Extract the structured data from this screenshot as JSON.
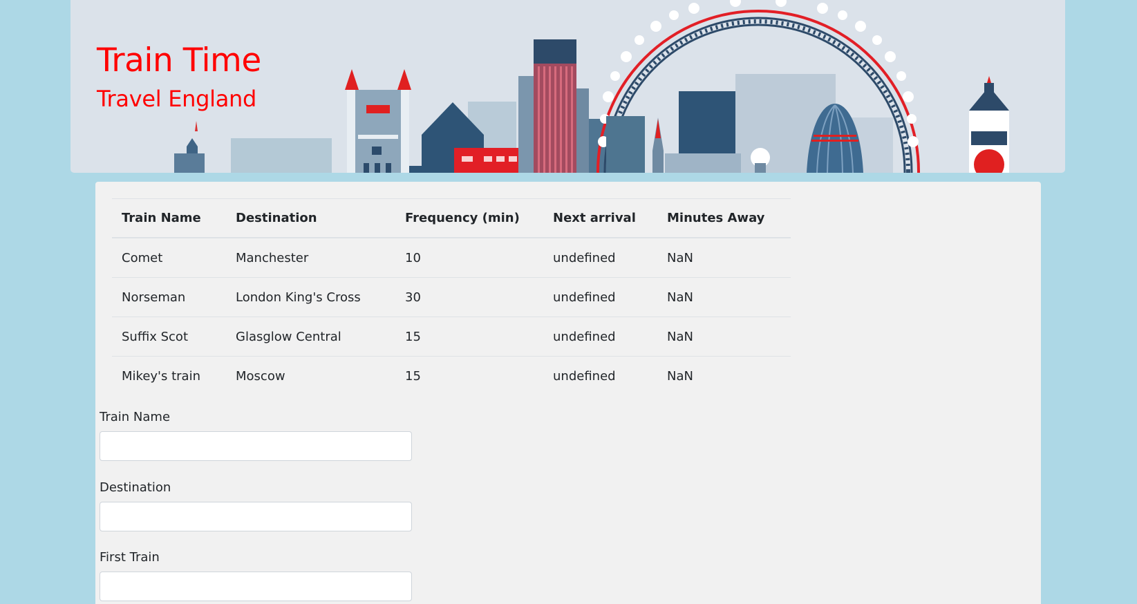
{
  "header": {
    "title": "Train Time",
    "subtitle": "Travel England"
  },
  "table": {
    "columns": [
      "Train Name",
      "Destination",
      "Frequency (min)",
      "Next arrival",
      "Minutes Away"
    ],
    "rows": [
      [
        "Comet",
        "Manchester",
        "10",
        "undefined",
        "NaN"
      ],
      [
        "Norseman",
        "London King's Cross",
        "30",
        "undefined",
        "NaN"
      ],
      [
        "Suffix Scot",
        "Glasglow Central",
        "15",
        "undefined",
        "NaN"
      ],
      [
        "Mikey's train",
        "Moscow",
        "15",
        "undefined",
        "NaN"
      ]
    ]
  },
  "form": {
    "train_name_label": "Train Name",
    "train_name_value": "",
    "destination_label": "Destination",
    "destination_value": "",
    "first_train_label": "First Train",
    "first_train_value": ""
  },
  "colors": {
    "page_background": "#add8e6",
    "title_color": "#ff0000",
    "panel_background": "#f1f1f1",
    "header_background": "#dbe2ea"
  }
}
